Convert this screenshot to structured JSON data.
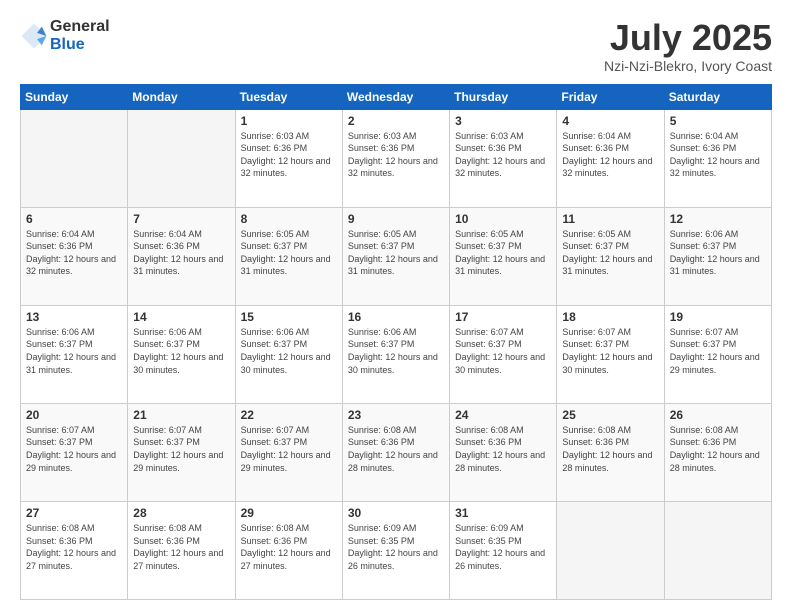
{
  "logo": {
    "general": "General",
    "blue": "Blue"
  },
  "title": {
    "month": "July 2025",
    "location": "Nzi-Nzi-Blekro, Ivory Coast"
  },
  "days_of_week": [
    "Sunday",
    "Monday",
    "Tuesday",
    "Wednesday",
    "Thursday",
    "Friday",
    "Saturday"
  ],
  "weeks": [
    [
      {
        "day": "",
        "info": ""
      },
      {
        "day": "",
        "info": ""
      },
      {
        "day": "1",
        "info": "Sunrise: 6:03 AM\nSunset: 6:36 PM\nDaylight: 12 hours and 32 minutes."
      },
      {
        "day": "2",
        "info": "Sunrise: 6:03 AM\nSunset: 6:36 PM\nDaylight: 12 hours and 32 minutes."
      },
      {
        "day": "3",
        "info": "Sunrise: 6:03 AM\nSunset: 6:36 PM\nDaylight: 12 hours and 32 minutes."
      },
      {
        "day": "4",
        "info": "Sunrise: 6:04 AM\nSunset: 6:36 PM\nDaylight: 12 hours and 32 minutes."
      },
      {
        "day": "5",
        "info": "Sunrise: 6:04 AM\nSunset: 6:36 PM\nDaylight: 12 hours and 32 minutes."
      }
    ],
    [
      {
        "day": "6",
        "info": "Sunrise: 6:04 AM\nSunset: 6:36 PM\nDaylight: 12 hours and 32 minutes."
      },
      {
        "day": "7",
        "info": "Sunrise: 6:04 AM\nSunset: 6:36 PM\nDaylight: 12 hours and 31 minutes."
      },
      {
        "day": "8",
        "info": "Sunrise: 6:05 AM\nSunset: 6:37 PM\nDaylight: 12 hours and 31 minutes."
      },
      {
        "day": "9",
        "info": "Sunrise: 6:05 AM\nSunset: 6:37 PM\nDaylight: 12 hours and 31 minutes."
      },
      {
        "day": "10",
        "info": "Sunrise: 6:05 AM\nSunset: 6:37 PM\nDaylight: 12 hours and 31 minutes."
      },
      {
        "day": "11",
        "info": "Sunrise: 6:05 AM\nSunset: 6:37 PM\nDaylight: 12 hours and 31 minutes."
      },
      {
        "day": "12",
        "info": "Sunrise: 6:06 AM\nSunset: 6:37 PM\nDaylight: 12 hours and 31 minutes."
      }
    ],
    [
      {
        "day": "13",
        "info": "Sunrise: 6:06 AM\nSunset: 6:37 PM\nDaylight: 12 hours and 31 minutes."
      },
      {
        "day": "14",
        "info": "Sunrise: 6:06 AM\nSunset: 6:37 PM\nDaylight: 12 hours and 30 minutes."
      },
      {
        "day": "15",
        "info": "Sunrise: 6:06 AM\nSunset: 6:37 PM\nDaylight: 12 hours and 30 minutes."
      },
      {
        "day": "16",
        "info": "Sunrise: 6:06 AM\nSunset: 6:37 PM\nDaylight: 12 hours and 30 minutes."
      },
      {
        "day": "17",
        "info": "Sunrise: 6:07 AM\nSunset: 6:37 PM\nDaylight: 12 hours and 30 minutes."
      },
      {
        "day": "18",
        "info": "Sunrise: 6:07 AM\nSunset: 6:37 PM\nDaylight: 12 hours and 30 minutes."
      },
      {
        "day": "19",
        "info": "Sunrise: 6:07 AM\nSunset: 6:37 PM\nDaylight: 12 hours and 29 minutes."
      }
    ],
    [
      {
        "day": "20",
        "info": "Sunrise: 6:07 AM\nSunset: 6:37 PM\nDaylight: 12 hours and 29 minutes."
      },
      {
        "day": "21",
        "info": "Sunrise: 6:07 AM\nSunset: 6:37 PM\nDaylight: 12 hours and 29 minutes."
      },
      {
        "day": "22",
        "info": "Sunrise: 6:07 AM\nSunset: 6:37 PM\nDaylight: 12 hours and 29 minutes."
      },
      {
        "day": "23",
        "info": "Sunrise: 6:08 AM\nSunset: 6:36 PM\nDaylight: 12 hours and 28 minutes."
      },
      {
        "day": "24",
        "info": "Sunrise: 6:08 AM\nSunset: 6:36 PM\nDaylight: 12 hours and 28 minutes."
      },
      {
        "day": "25",
        "info": "Sunrise: 6:08 AM\nSunset: 6:36 PM\nDaylight: 12 hours and 28 minutes."
      },
      {
        "day": "26",
        "info": "Sunrise: 6:08 AM\nSunset: 6:36 PM\nDaylight: 12 hours and 28 minutes."
      }
    ],
    [
      {
        "day": "27",
        "info": "Sunrise: 6:08 AM\nSunset: 6:36 PM\nDaylight: 12 hours and 27 minutes."
      },
      {
        "day": "28",
        "info": "Sunrise: 6:08 AM\nSunset: 6:36 PM\nDaylight: 12 hours and 27 minutes."
      },
      {
        "day": "29",
        "info": "Sunrise: 6:08 AM\nSunset: 6:36 PM\nDaylight: 12 hours and 27 minutes."
      },
      {
        "day": "30",
        "info": "Sunrise: 6:09 AM\nSunset: 6:35 PM\nDaylight: 12 hours and 26 minutes."
      },
      {
        "day": "31",
        "info": "Sunrise: 6:09 AM\nSunset: 6:35 PM\nDaylight: 12 hours and 26 minutes."
      },
      {
        "day": "",
        "info": ""
      },
      {
        "day": "",
        "info": ""
      }
    ]
  ]
}
